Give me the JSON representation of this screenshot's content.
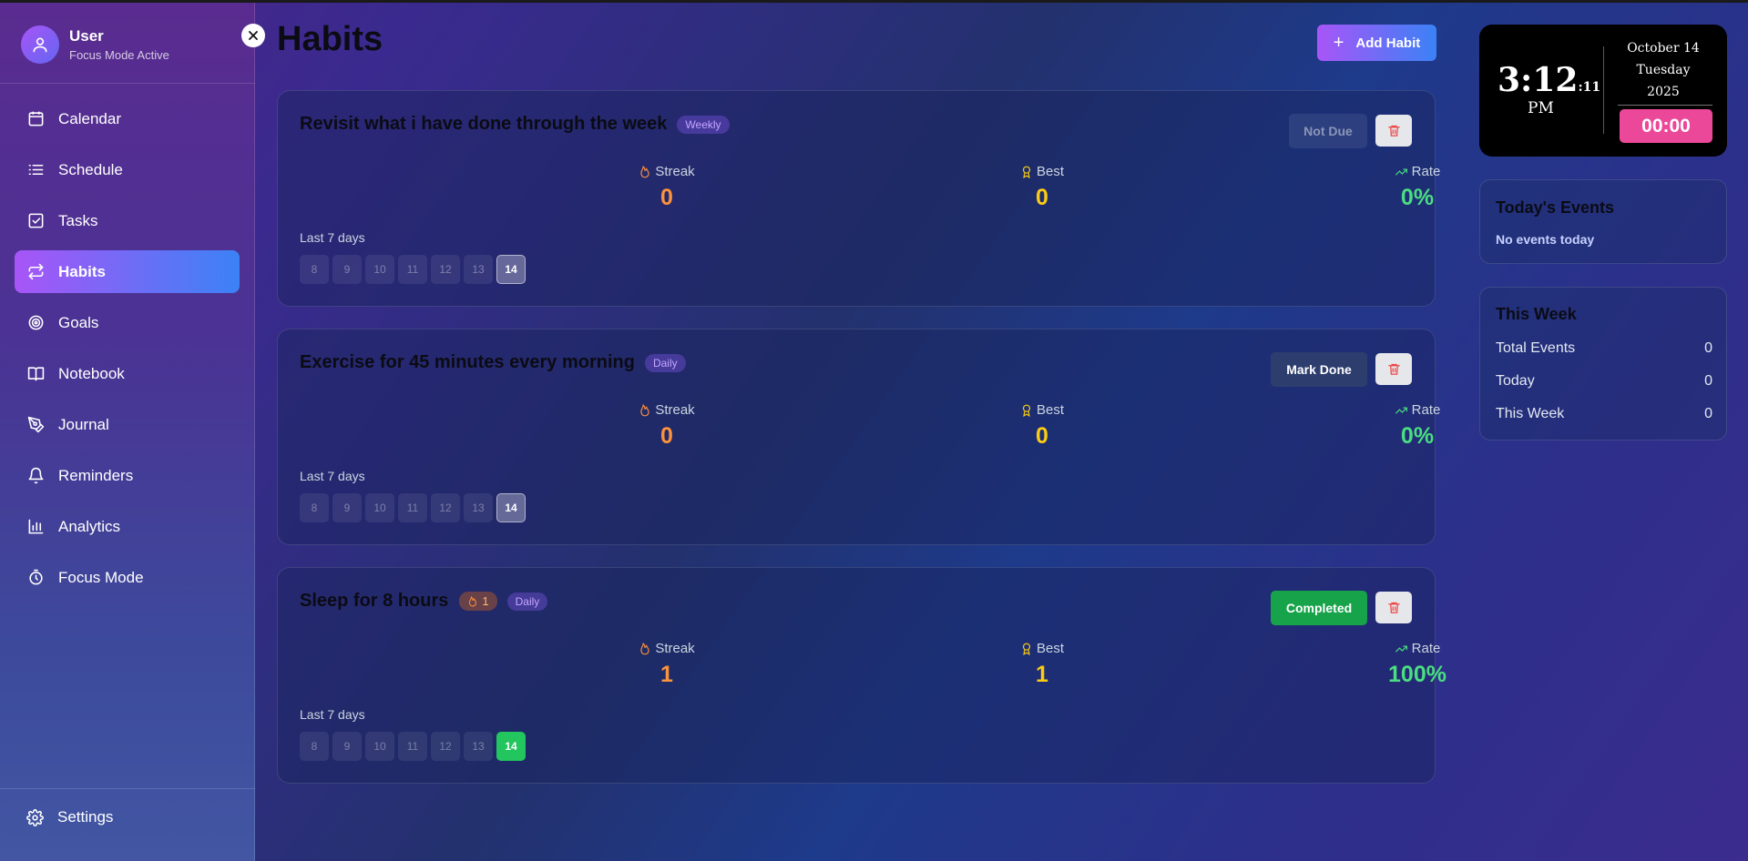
{
  "user": {
    "name": "User",
    "status": "Focus Mode Active"
  },
  "sidebar": {
    "items": [
      {
        "label": "Calendar",
        "icon": "calendar-icon"
      },
      {
        "label": "Schedule",
        "icon": "list-icon"
      },
      {
        "label": "Tasks",
        "icon": "checkbox-icon"
      },
      {
        "label": "Habits",
        "icon": "repeat-icon",
        "active": true
      },
      {
        "label": "Goals",
        "icon": "target-icon"
      },
      {
        "label": "Notebook",
        "icon": "book-icon"
      },
      {
        "label": "Journal",
        "icon": "pen-icon"
      },
      {
        "label": "Reminders",
        "icon": "bell-icon"
      },
      {
        "label": "Analytics",
        "icon": "bar-chart-icon"
      },
      {
        "label": "Focus Mode",
        "icon": "timer-icon"
      }
    ],
    "settings_label": "Settings"
  },
  "page": {
    "title": "Habits",
    "add_button": "Add Habit"
  },
  "stat_labels": {
    "streak": "Streak",
    "best": "Best",
    "rate": "Rate"
  },
  "last7_label": "Last 7 days",
  "habits": [
    {
      "title": "Revisit what i have done through the week",
      "frequency": "Weekly",
      "action": "Not Due",
      "streak": "0",
      "best": "0",
      "rate": "0%",
      "days": [
        "8",
        "9",
        "10",
        "11",
        "12",
        "13",
        "14"
      ]
    },
    {
      "title": "Exercise for 45 minutes every morning",
      "frequency": "Daily",
      "action": "Mark Done",
      "streak": "0",
      "best": "0",
      "rate": "0%",
      "days": [
        "8",
        "9",
        "10",
        "11",
        "12",
        "13",
        "14"
      ]
    },
    {
      "title": "Sleep for 8 hours",
      "streak_badge": "1",
      "frequency": "Daily",
      "action": "Completed",
      "streak": "1",
      "best": "1",
      "rate": "100%",
      "days": [
        "8",
        "9",
        "10",
        "11",
        "12",
        "13",
        "14"
      ]
    }
  ],
  "clock": {
    "time": "3:12",
    "seconds": ":11",
    "ampm": "PM",
    "date": "October 14",
    "weekday": "Tuesday",
    "year": "2025",
    "timer": "00:00"
  },
  "today_events": {
    "title": "Today's Events",
    "empty": "No events today"
  },
  "this_week": {
    "title": "This Week",
    "rows": [
      {
        "label": "Total Events",
        "value": "0"
      },
      {
        "label": "Today",
        "value": "0"
      },
      {
        "label": "This Week",
        "value": "0"
      }
    ]
  },
  "colors": {
    "accent_gradient_start": "#a855f7",
    "accent_gradient_end": "#3b82f6",
    "streak": "#fb923c",
    "best": "#facc15",
    "rate": "#4ade80",
    "completed": "#16a34a",
    "timer": "#ec4899"
  }
}
